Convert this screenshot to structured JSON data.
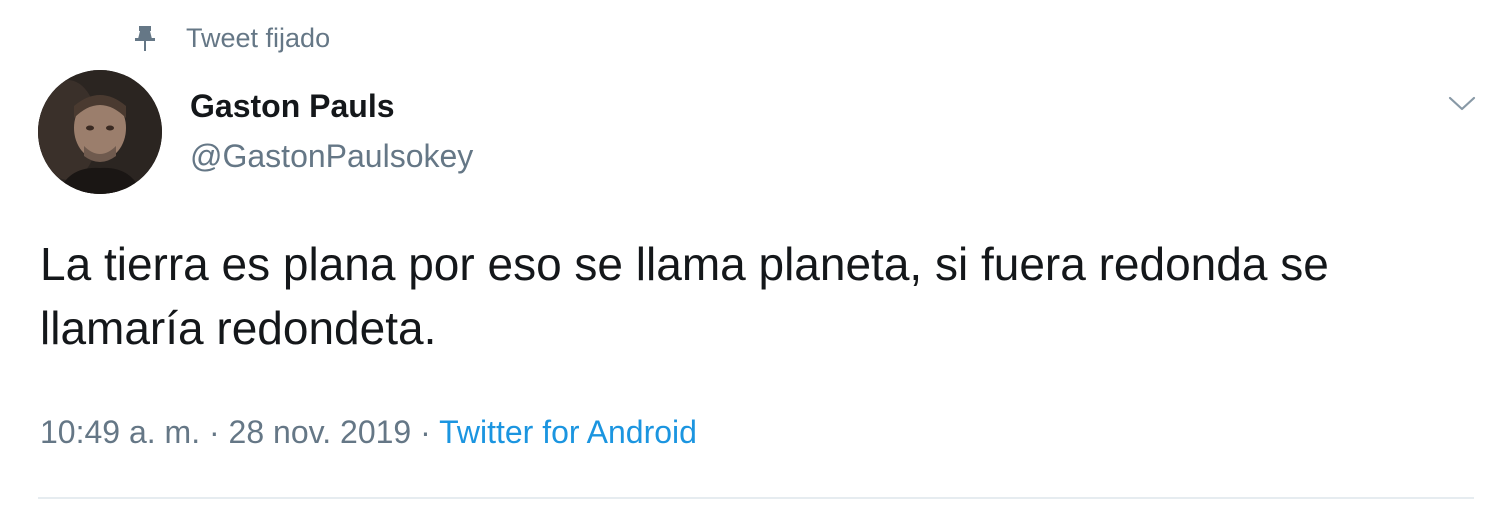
{
  "pinned": {
    "label": "Tweet fijado",
    "icon": "pin-icon"
  },
  "author": {
    "display_name": "Gaston Pauls",
    "handle": "@GastonPaulsokey",
    "avatar": "avatar-photo"
  },
  "menu": {
    "icon": "chevron-down-icon"
  },
  "tweet": {
    "text": "La tierra es plana por eso se llama planeta, si fuera redonda se llamaría redondeta.",
    "time": "10:49 a. m.",
    "separator_1": " · ",
    "date": "28 nov. 2019",
    "separator_2": " · ",
    "source": "Twitter for Android"
  },
  "colors": {
    "text_primary": "#14171a",
    "text_secondary": "#657786",
    "link": "#1b95e0",
    "divider": "#e6ecf0"
  }
}
